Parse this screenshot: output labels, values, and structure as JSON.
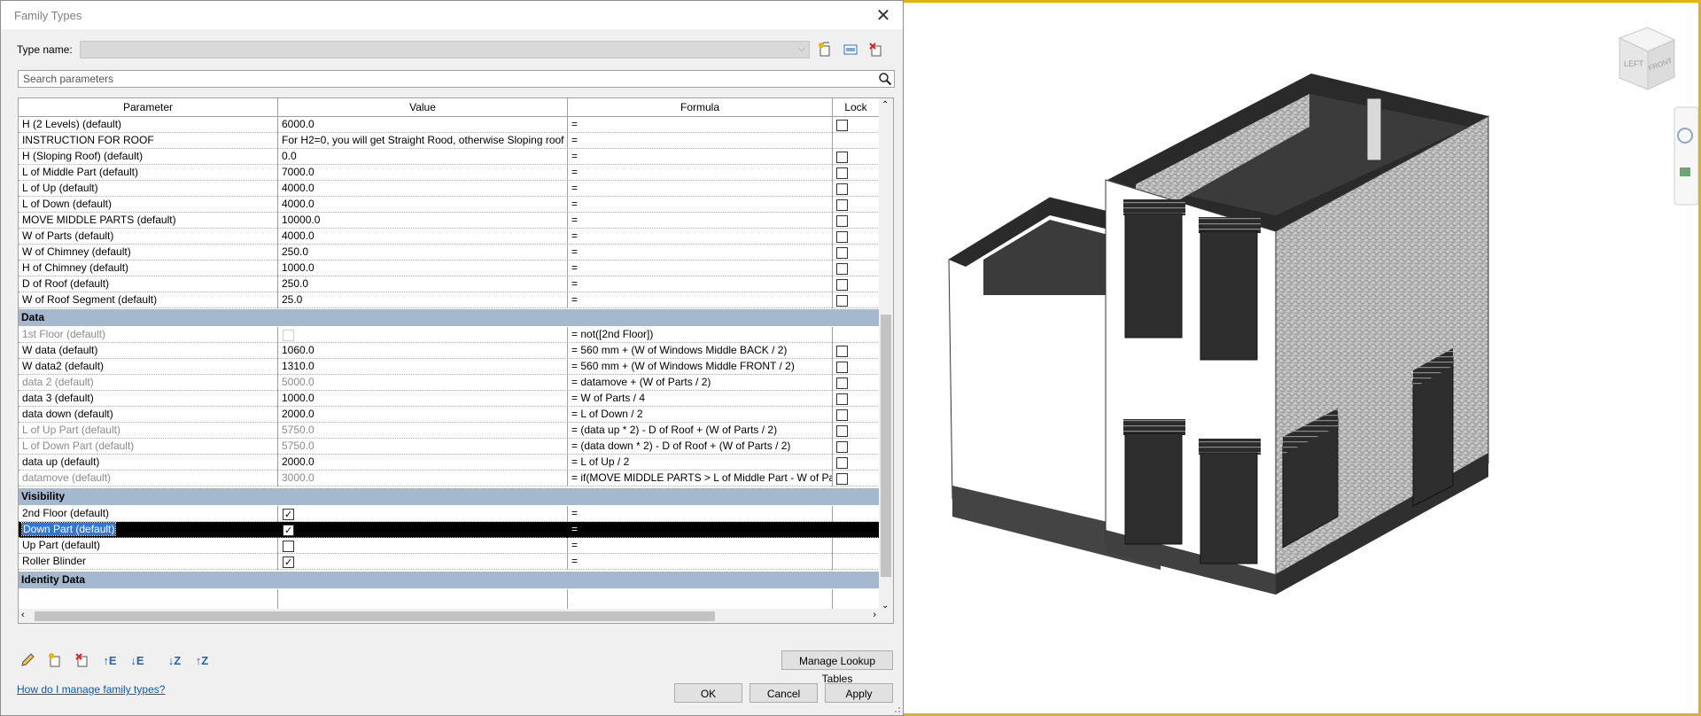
{
  "dialog": {
    "title": "Family Types",
    "type_name_label": "Type name:",
    "type_name_value": "",
    "search_placeholder": "Search parameters"
  },
  "grid": {
    "columns": [
      "Parameter",
      "Value",
      "Formula",
      "Lock"
    ],
    "rows_top": [
      {
        "param": "H (2 Levels) (default)",
        "value": "6000.0",
        "formula": "=",
        "lock": false,
        "grey": false
      },
      {
        "param": "INSTRUCTION FOR ROOF",
        "value": "For H2=0, you will get Straight Rood, otherwise Sloping roof",
        "formula": "=",
        "lock": null,
        "grey": false
      },
      {
        "param": "H (Sloping Roof) (default)",
        "value": "0.0",
        "formula": "=",
        "lock": false,
        "grey": false
      },
      {
        "param": "L of Middle Part (default)",
        "value": "7000.0",
        "formula": "=",
        "lock": false,
        "grey": false
      },
      {
        "param": "L of Up (default)",
        "value": "4000.0",
        "formula": "=",
        "lock": false,
        "grey": false
      },
      {
        "param": "L of Down (default)",
        "value": "4000.0",
        "formula": "=",
        "lock": false,
        "grey": false
      },
      {
        "param": "MOVE MIDDLE PARTS (default)",
        "value": "10000.0",
        "formula": "=",
        "lock": false,
        "grey": false
      },
      {
        "param": "W of Parts (default)",
        "value": "4000.0",
        "formula": "=",
        "lock": false,
        "grey": false
      },
      {
        "param": "W of Chimney (default)",
        "value": "250.0",
        "formula": "=",
        "lock": false,
        "grey": false
      },
      {
        "param": "H of Chimney (default)",
        "value": "1000.0",
        "formula": "=",
        "lock": false,
        "grey": false
      },
      {
        "param": "D of Roof (default)",
        "value": "250.0",
        "formula": "=",
        "lock": false,
        "grey": false
      },
      {
        "param": "W of Roof Segment (default)",
        "value": "25.0",
        "formula": "=",
        "lock": false,
        "grey": false
      }
    ],
    "group_data": "Data",
    "rows_data": [
      {
        "param": "1st Floor (default)",
        "value_check": "grey",
        "formula": "= not([2nd Floor])",
        "lock": null,
        "grey": true
      },
      {
        "param": "W data (default)",
        "value": "1060.0",
        "formula": "= 560 mm + (W of Windows Middle BACK / 2)",
        "lock": false,
        "grey": false
      },
      {
        "param": "W data2 (default)",
        "value": "1310.0",
        "formula": "= 560 mm + (W of Windows Middle FRONT / 2)",
        "lock": false,
        "grey": false
      },
      {
        "param": "data 2 (default)",
        "value": "5000.0",
        "formula": "= datamove + (W of Parts / 2)",
        "lock": false,
        "grey": true
      },
      {
        "param": "data 3 (default)",
        "value": "1000.0",
        "formula": "= W of Parts / 4",
        "lock": false,
        "grey": false
      },
      {
        "param": "data down (default)",
        "value": "2000.0",
        "formula": "= L of Down / 2",
        "lock": false,
        "grey": false
      },
      {
        "param": "L of Up Part (default)",
        "value": "5750.0",
        "formula": "= (data up * 2) - D of Roof + (W of Parts / 2)",
        "lock": false,
        "grey": true
      },
      {
        "param": "L of Down Part (default)",
        "value": "5750.0",
        "formula": "= (data down * 2) - D of Roof + (W of Parts / 2)",
        "lock": false,
        "grey": true
      },
      {
        "param": "data up (default)",
        "value": "2000.0",
        "formula": "= L of Up / 2",
        "lock": false,
        "grey": false
      },
      {
        "param": "datamove (default)",
        "value": "3000.0",
        "formula": "= if(MOVE MIDDLE PARTS > L of Middle Part - W of Part",
        "lock": false,
        "grey": true
      }
    ],
    "group_visibility": "Visibility",
    "rows_visibility": [
      {
        "param": "2nd Floor (default)",
        "checked": true,
        "formula": "=",
        "selected": false
      },
      {
        "param": "Down Part (default)",
        "checked": true,
        "formula": "=",
        "selected": true
      },
      {
        "param": "Up Part (default)",
        "checked": false,
        "formula": "=",
        "selected": false
      },
      {
        "param": "Roller Blinder",
        "checked": true,
        "formula": "=",
        "selected": false
      }
    ],
    "group_identity": "Identity Data"
  },
  "buttons": {
    "manage_lookup": "Manage Lookup Tables",
    "ok": "OK",
    "cancel": "Cancel",
    "apply": "Apply"
  },
  "help_link": "How do I manage family types?",
  "view_cube": {
    "left": "LEFT",
    "front": "FRONT"
  },
  "colors": {
    "group_header": "#a4b8cf",
    "selection": "#000000",
    "link": "#0a58b5",
    "viewport_border": "#e0b11b"
  }
}
